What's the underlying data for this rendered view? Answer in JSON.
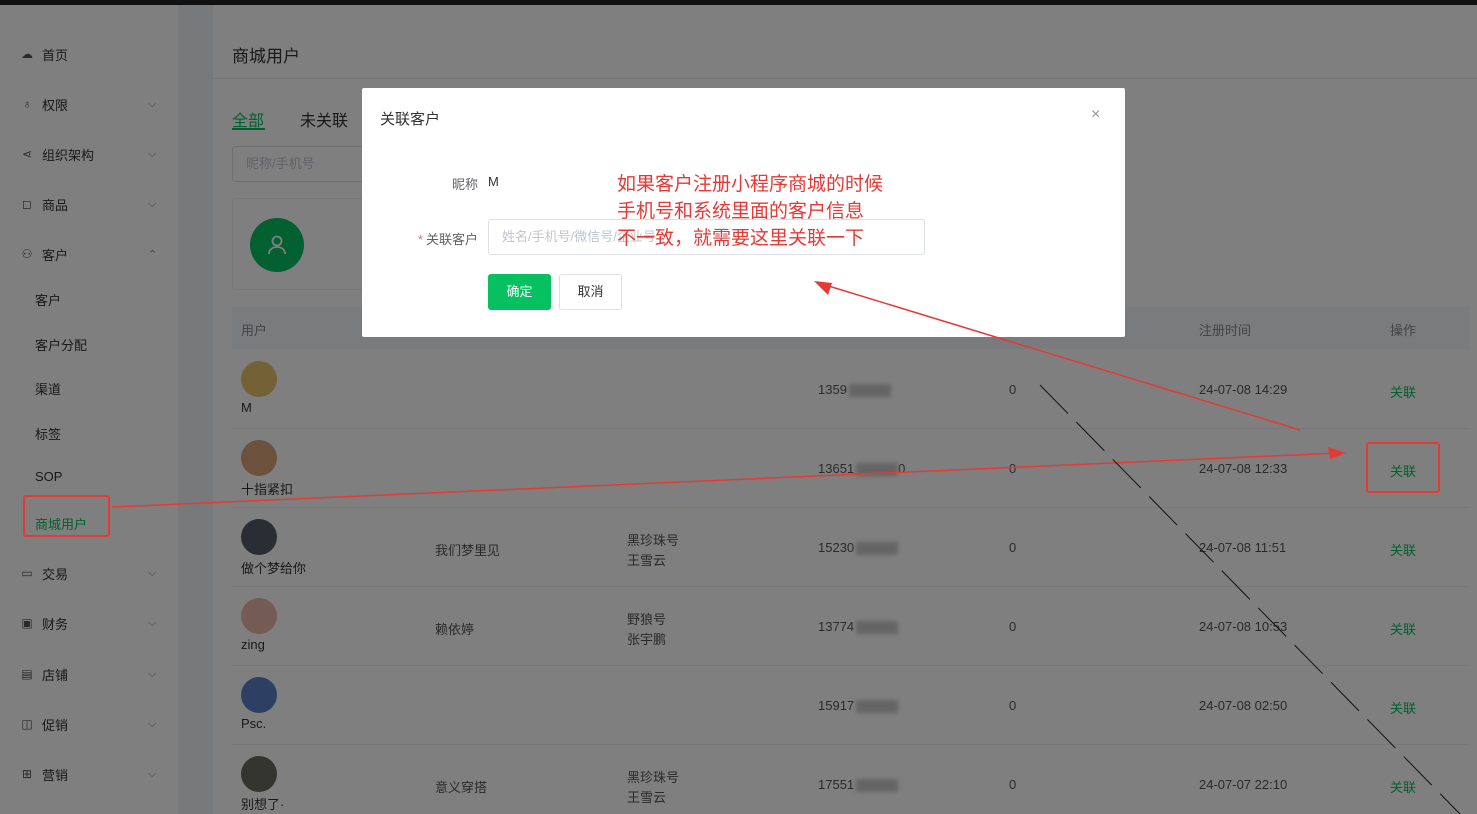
{
  "sidebar": {
    "items": [
      {
        "label": "首页",
        "icon": "cloud-icon"
      },
      {
        "label": "权限",
        "icon": "key-icon"
      },
      {
        "label": "组织架构",
        "icon": "share-icon"
      },
      {
        "label": "商品",
        "icon": "bag-icon"
      },
      {
        "label": "客户",
        "icon": "user-icon"
      },
      {
        "label": "交易",
        "icon": "folder-icon"
      },
      {
        "label": "财务",
        "icon": "wallet-icon"
      },
      {
        "label": "店铺",
        "icon": "store-icon"
      },
      {
        "label": "促销",
        "icon": "gift-icon"
      },
      {
        "label": "营销",
        "icon": "grid-icon"
      }
    ],
    "customer_sub": [
      "客户",
      "客户分配",
      "渠道",
      "标签",
      "SOP",
      "商城用户"
    ]
  },
  "page": {
    "title": "商城用户",
    "tabs": [
      "全部",
      "未关联"
    ],
    "search_placeholder": "昵称/手机号"
  },
  "table": {
    "headers": {
      "user": "用户",
      "register_time": "注册时间",
      "action": "操作"
    },
    "rows": [
      {
        "name": "M",
        "customer": "",
        "shop": "",
        "owner": "",
        "phone": "1359",
        "phone_tail": "",
        "count": "0",
        "time": "24-07-08 14:29",
        "action": "关联"
      },
      {
        "name": "十指紧扣",
        "customer": "",
        "shop": "",
        "owner": "",
        "phone": "13651",
        "phone_tail": "0",
        "count": "0",
        "time": "24-07-08 12:33",
        "action": "关联"
      },
      {
        "name": "做个梦给你",
        "customer": "我们梦里见",
        "shop": "黑珍珠号",
        "owner": "王雪云",
        "phone": "15230",
        "phone_tail": "",
        "count": "0",
        "time": "24-07-08 11:51",
        "action": "关联"
      },
      {
        "name": "zing",
        "customer": "赖依婷",
        "shop": "野狼号",
        "owner": "张宇鹏",
        "phone": "13774",
        "phone_tail": "",
        "count": "0",
        "time": "24-07-08 10:53",
        "action": "关联"
      },
      {
        "name": "Psc.",
        "customer": "",
        "shop": "",
        "owner": "",
        "phone": "15917",
        "phone_tail": "",
        "count": "0",
        "time": "24-07-08 02:50",
        "action": "关联"
      },
      {
        "name": "别想了·",
        "customer": "意义穿搭",
        "shop": "黑珍珠号",
        "owner": "王雪云",
        "phone": "17551",
        "phone_tail": "",
        "count": "0",
        "time": "24-07-07 22:10",
        "action": "关联"
      }
    ]
  },
  "dialog": {
    "title": "关联客户",
    "nickname_label": "昵称",
    "nickname_value": "M",
    "link_label": "关联客户",
    "required_mark": "*",
    "link_placeholder": "姓名/手机号/微信号/企业号",
    "confirm": "确定",
    "cancel": "取消",
    "close": "×"
  },
  "annotation": {
    "lines": [
      "如果客户注册小程序商城的时候",
      "手机号和系统里面的客户信息",
      "不一致，就需要这里关联一下"
    ]
  },
  "colors": {
    "accent": "#07c160",
    "annotation": "#e53935"
  }
}
